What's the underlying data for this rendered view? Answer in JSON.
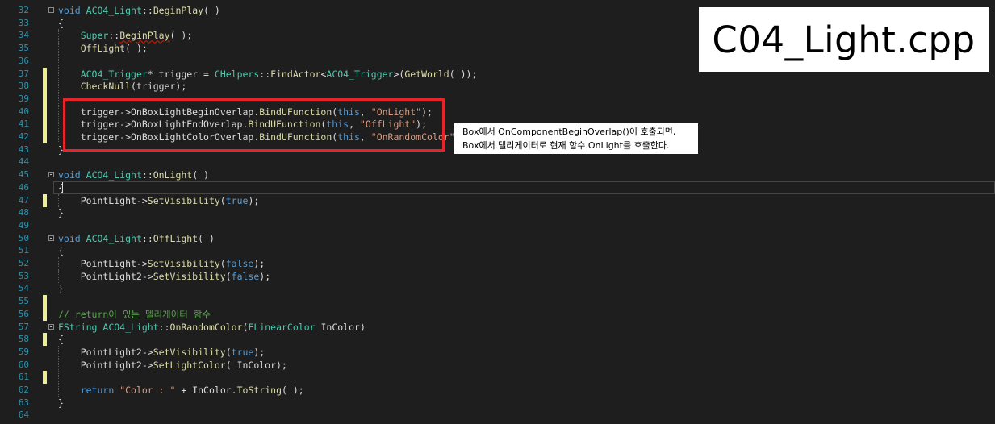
{
  "title_box": {
    "text": "C04_Light.cpp"
  },
  "callout": {
    "line1": "Box에서 OnComponentBeginOverlap()이 호출되면,",
    "line2": "Box에서 델리게이터로 현재 함수 OnLight를 호출한다."
  },
  "colors": {
    "background": "#1e1e1e",
    "line_number": "#2b91af",
    "keyword": "#569cd6",
    "function": "#dcdcaa",
    "type": "#4ec9b0",
    "string": "#d69d85",
    "comment": "#57a64a",
    "change_marker": "#efef91",
    "highlight_border": "#e8232a"
  },
  "lines": [
    {
      "n": "32",
      "fold": true,
      "tokens": [
        [
          "kw",
          "void"
        ],
        [
          "txt",
          " "
        ],
        [
          "ty",
          "ACO4_Light"
        ],
        [
          "txt",
          "::"
        ],
        [
          "fn",
          "BeginPlay"
        ],
        [
          "txt",
          "( )"
        ]
      ]
    },
    {
      "n": "33",
      "guide": true,
      "tokens": [
        [
          "txt",
          "{"
        ]
      ]
    },
    {
      "n": "34",
      "guide": true,
      "tokens": [
        [
          "txt",
          "    "
        ],
        [
          "ty",
          "Super"
        ],
        [
          "txt",
          "::"
        ],
        [
          "fnsq",
          "BeginPlay"
        ],
        [
          "txt",
          "( );"
        ]
      ]
    },
    {
      "n": "35",
      "guide": true,
      "tokens": [
        [
          "txt",
          "    "
        ],
        [
          "fn",
          "OffLight"
        ],
        [
          "txt",
          "( );"
        ]
      ]
    },
    {
      "n": "36",
      "guide": true,
      "tokens": []
    },
    {
      "n": "37",
      "mark": true,
      "guide": true,
      "tokens": [
        [
          "txt",
          "    "
        ],
        [
          "ty",
          "ACO4_Trigger"
        ],
        [
          "txt",
          "* trigger = "
        ],
        [
          "ty",
          "CHelpers"
        ],
        [
          "txt",
          "::"
        ],
        [
          "fn",
          "FindActor"
        ],
        [
          "txt",
          "<"
        ],
        [
          "ty",
          "ACO4_Trigger"
        ],
        [
          "txt",
          ">("
        ],
        [
          "fn",
          "GetWorld"
        ],
        [
          "txt",
          "( ));"
        ]
      ]
    },
    {
      "n": "38",
      "mark": true,
      "guide": true,
      "tokens": [
        [
          "txt",
          "    "
        ],
        [
          "fn",
          "CheckNull"
        ],
        [
          "txt",
          "(trigger);"
        ]
      ]
    },
    {
      "n": "39",
      "mark": true,
      "guide": true,
      "tokens": []
    },
    {
      "n": "40",
      "mark": true,
      "guide": true,
      "tokens": [
        [
          "txt",
          "    trigger->OnBoxLightBeginOverlap."
        ],
        [
          "fn",
          "BindUFunction"
        ],
        [
          "txt",
          "("
        ],
        [
          "kw",
          "this"
        ],
        [
          "txt",
          ", "
        ],
        [
          "str",
          "\"OnLight\""
        ],
        [
          "txt",
          ");"
        ]
      ]
    },
    {
      "n": "41",
      "mark": true,
      "guide": true,
      "tokens": [
        [
          "txt",
          "    trigger->OnBoxLightEndOverlap."
        ],
        [
          "fn",
          "BindUFunction"
        ],
        [
          "txt",
          "("
        ],
        [
          "kw",
          "this"
        ],
        [
          "txt",
          ", "
        ],
        [
          "str",
          "\"OffLight\""
        ],
        [
          "txt",
          ");"
        ]
      ]
    },
    {
      "n": "42",
      "mark": true,
      "guide": true,
      "tokens": [
        [
          "txt",
          "    trigger->OnBoxLightColorOverlap."
        ],
        [
          "fn",
          "BindUFunction"
        ],
        [
          "txt",
          "("
        ],
        [
          "kw",
          "this"
        ],
        [
          "txt",
          ", "
        ],
        [
          "str",
          "\"OnRandomColor\""
        ],
        [
          "txt",
          ");"
        ]
      ]
    },
    {
      "n": "43",
      "guide": true,
      "tokens": [
        [
          "txt",
          "}"
        ]
      ]
    },
    {
      "n": "44",
      "tokens": []
    },
    {
      "n": "45",
      "fold": true,
      "tokens": [
        [
          "kw",
          "void"
        ],
        [
          "txt",
          " "
        ],
        [
          "ty",
          "ACO4_Light"
        ],
        [
          "txt",
          "::"
        ],
        [
          "fn",
          "OnLight"
        ],
        [
          "txt",
          "( )"
        ]
      ]
    },
    {
      "n": "46",
      "guide": true,
      "current": true,
      "tokens": [
        [
          "txt",
          "{"
        ]
      ]
    },
    {
      "n": "47",
      "mark": true,
      "guide": true,
      "tokens": [
        [
          "txt",
          "    PointLight->"
        ],
        [
          "fn",
          "SetVisibility"
        ],
        [
          "txt",
          "("
        ],
        [
          "kw",
          "true"
        ],
        [
          "txt",
          ");"
        ]
      ]
    },
    {
      "n": "48",
      "guide": true,
      "tokens": [
        [
          "txt",
          "}"
        ]
      ]
    },
    {
      "n": "49",
      "tokens": []
    },
    {
      "n": "50",
      "fold": true,
      "tokens": [
        [
          "kw",
          "void"
        ],
        [
          "txt",
          " "
        ],
        [
          "ty",
          "ACO4_Light"
        ],
        [
          "txt",
          "::"
        ],
        [
          "fn",
          "OffLight"
        ],
        [
          "txt",
          "( )"
        ]
      ]
    },
    {
      "n": "51",
      "guide": true,
      "tokens": [
        [
          "txt",
          "{"
        ]
      ]
    },
    {
      "n": "52",
      "guide": true,
      "tokens": [
        [
          "txt",
          "    PointLight->"
        ],
        [
          "fn",
          "SetVisibility"
        ],
        [
          "txt",
          "("
        ],
        [
          "kw",
          "false"
        ],
        [
          "txt",
          ");"
        ]
      ]
    },
    {
      "n": "53",
      "guide": true,
      "tokens": [
        [
          "txt",
          "    PointLight2->"
        ],
        [
          "fn",
          "SetVisibility"
        ],
        [
          "txt",
          "("
        ],
        [
          "kw",
          "false"
        ],
        [
          "txt",
          ");"
        ]
      ]
    },
    {
      "n": "54",
      "guide": true,
      "tokens": [
        [
          "txt",
          "}"
        ]
      ]
    },
    {
      "n": "55",
      "mark": true,
      "tokens": []
    },
    {
      "n": "56",
      "mark": true,
      "tokens": [
        [
          "com",
          "// return이 있는 델리게이터 함수"
        ]
      ]
    },
    {
      "n": "57",
      "fold": true,
      "tokens": [
        [
          "ty",
          "FString"
        ],
        [
          "txt",
          " "
        ],
        [
          "ty",
          "ACO4_Light"
        ],
        [
          "txt",
          "::"
        ],
        [
          "fn",
          "OnRandomColor"
        ],
        [
          "txt",
          "("
        ],
        [
          "ty",
          "FLinearColor"
        ],
        [
          "txt",
          " InColor)"
        ]
      ]
    },
    {
      "n": "58",
      "mark": true,
      "guide": true,
      "tokens": [
        [
          "txt",
          "{"
        ]
      ]
    },
    {
      "n": "59",
      "guide": true,
      "tokens": [
        [
          "txt",
          "    PointLight2->"
        ],
        [
          "fn",
          "SetVisibility"
        ],
        [
          "txt",
          "("
        ],
        [
          "kw",
          "true"
        ],
        [
          "txt",
          ");"
        ]
      ]
    },
    {
      "n": "60",
      "guide": true,
      "tokens": [
        [
          "txt",
          "    PointLight2->"
        ],
        [
          "fn",
          "SetLightColor"
        ],
        [
          "txt",
          "( InColor);"
        ]
      ]
    },
    {
      "n": "61",
      "mark": true,
      "guide": true,
      "tokens": []
    },
    {
      "n": "62",
      "guide": true,
      "tokens": [
        [
          "txt",
          "    "
        ],
        [
          "kw",
          "return"
        ],
        [
          "txt",
          " "
        ],
        [
          "str",
          "\"Color : \""
        ],
        [
          "txt",
          " + InColor."
        ],
        [
          "fn",
          "ToString"
        ],
        [
          "txt",
          "( );"
        ]
      ]
    },
    {
      "n": "63",
      "guide": true,
      "tokens": [
        [
          "txt",
          "}"
        ]
      ]
    },
    {
      "n": "64",
      "tokens": []
    }
  ]
}
